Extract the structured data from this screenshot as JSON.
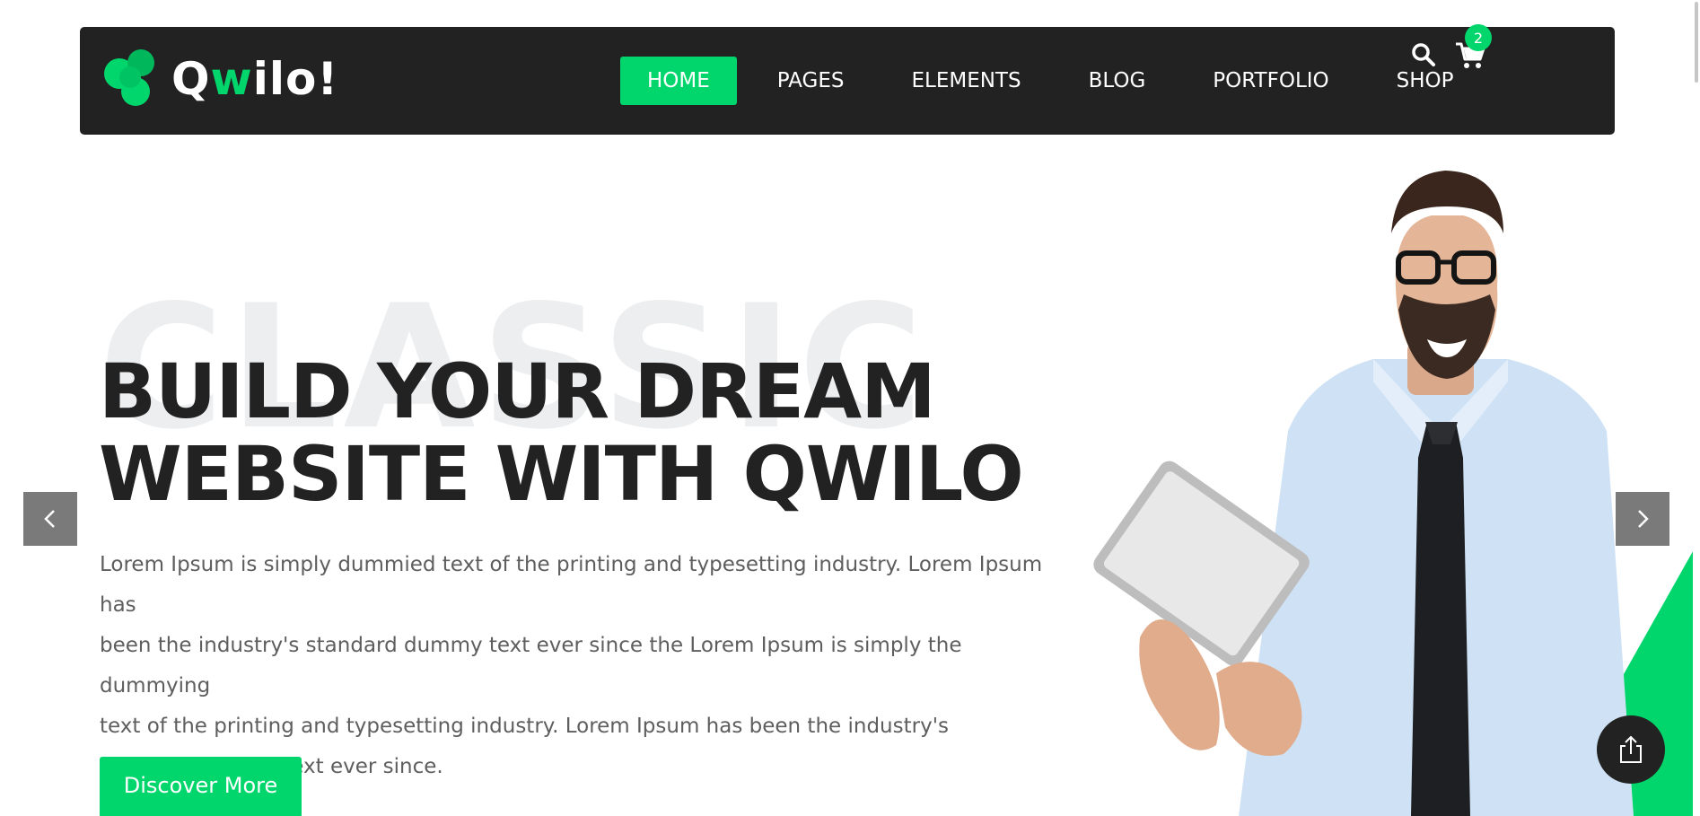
{
  "brand": {
    "name_before": "Q",
    "name_accent": "w",
    "name_after": "ilo!",
    "accent_color": "#00d66b",
    "nav_bg": "#222222"
  },
  "nav": {
    "items": [
      {
        "label": "HOME",
        "active": true
      },
      {
        "label": "PAGES",
        "active": false
      },
      {
        "label": "ELEMENTS",
        "active": false
      },
      {
        "label": "BLOG",
        "active": false
      },
      {
        "label": "PORTFOLIO",
        "active": false
      },
      {
        "label": "SHOP",
        "active": false
      }
    ],
    "search_icon": "search-icon",
    "cart_icon": "cart-icon",
    "cart_count": "2"
  },
  "hero": {
    "background_word": "CLASSIC",
    "headline_line1": "BUILD YOUR DREAM",
    "headline_line2": "WEBSITE WITH QWILO",
    "lead_lines": [
      "Lorem Ipsum is simply dummied text of the printing and typesetting industry. Lorem Ipsum has",
      "been the industry's standard dummy text ever since the Lorem Ipsum is simply the dummying",
      "text of the printing and typesetting industry. Lorem Ipsum has been the industry's",
      "standard dummy text ever since."
    ],
    "cta_label": "Discover More"
  },
  "slider": {
    "prev_icon": "chevron-left-icon",
    "next_icon": "chevron-right-icon"
  },
  "share": {
    "icon": "share-icon"
  }
}
